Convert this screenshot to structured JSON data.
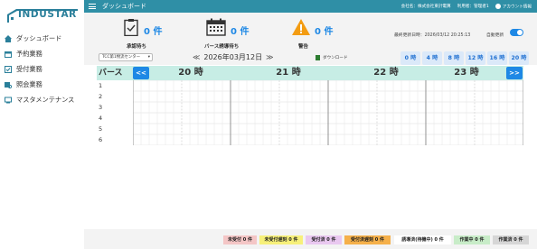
{
  "logo": {
    "text": "INDUSTAR"
  },
  "sidebar": {
    "items": [
      {
        "label": "ダッシュボード",
        "icon": "home-icon"
      },
      {
        "label": "予約業務",
        "icon": "calendar-icon"
      },
      {
        "label": "受付業務",
        "icon": "reception-icon"
      },
      {
        "label": "照会業務",
        "icon": "inquiry-icon"
      },
      {
        "label": "マスタメンテナンス",
        "icon": "master-icon"
      }
    ]
  },
  "topbar": {
    "title": "ダッシュボード",
    "company": "会社名：株式会社東計電算",
    "user": "利用者：管理者1",
    "account": "アカウント情報"
  },
  "status": {
    "approval": {
      "count": "0 件",
      "label": "承認待ち"
    },
    "berth_wait": {
      "count": "0 件",
      "label": "バース誘導待ち"
    },
    "warning": {
      "count": "0 件",
      "label": "警告"
    },
    "last_updated": "最終更新日時：2026/03/12 20:25:13",
    "auto_update": "自動更新",
    "auto_update_on": true
  },
  "toolbar": {
    "center": "TCC第1物流センター",
    "date": "2026年03月12日",
    "prev": "≪",
    "next": "≫",
    "download": "ダウンロード",
    "hour_buttons": [
      "0 時",
      "4 時",
      "8 時",
      "12 時",
      "16 時",
      "20 時"
    ]
  },
  "gantt": {
    "berth_header": "バース",
    "prev_btn": "<<",
    "next_btn": ">>",
    "hours": [
      "20 時",
      "21 時",
      "22 時",
      "23 時"
    ],
    "rows": [
      "1",
      "2",
      "3",
      "4",
      "5",
      "6"
    ]
  },
  "legend": [
    {
      "label": "未受付 0 件",
      "color": "#f4c6c6"
    },
    {
      "label": "未受付遅刻 0 件",
      "color": "#f7f07a"
    },
    {
      "label": "受付済 0 件",
      "color": "#e9c8f0"
    },
    {
      "label": "受付済遅刻 0 件",
      "color": "#f5b04a"
    },
    {
      "label": "誘導済(待機中) 0 件",
      "color": "#ffffff"
    },
    {
      "label": "作業中 0 件",
      "color": "#c8ecc8"
    },
    {
      "label": "作業済 0 件",
      "color": "#d6d6d6"
    }
  ]
}
